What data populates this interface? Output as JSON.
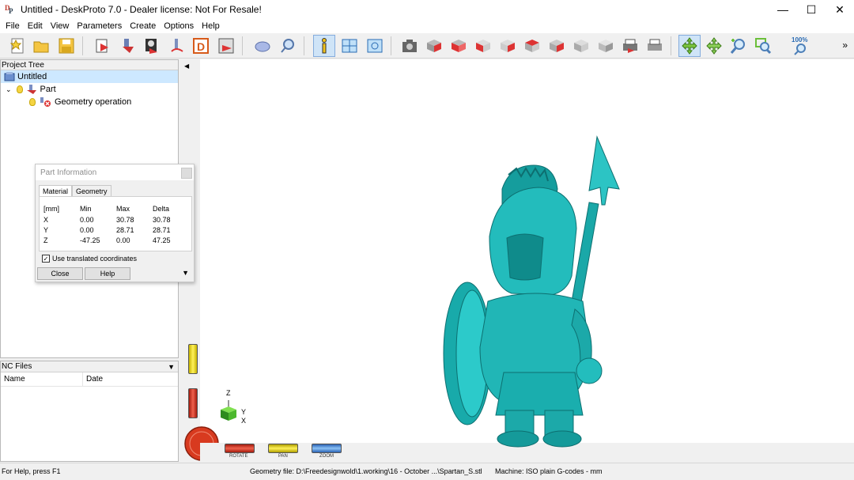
{
  "window": {
    "title": "Untitled - DeskProto 7.0 - Dealer license: Not For Resale!",
    "minimize": "—",
    "maximize": "☐",
    "close": "✕"
  },
  "menu": [
    "File",
    "Edit",
    "View",
    "Parameters",
    "Create",
    "Options",
    "Help"
  ],
  "toolbar": {
    "zoom_label": "100%",
    "more": "»",
    "icons": [
      "new-project-icon",
      "open-icon",
      "save-icon",
      "load-geometry-icon",
      "part-icon",
      "bitmap-icon",
      "toolpath-icon",
      "d-icon",
      "export-icon",
      "shapes-icon",
      "preview-icon",
      "info-icon",
      "layout-icon",
      "view-icon",
      "camera-icon",
      "view-front-icon",
      "view-back-icon",
      "view-left-icon",
      "view-right-icon",
      "view-top-icon",
      "view-bottom-icon",
      "view-iso-icon",
      "view-iso2-icon",
      "print-icon",
      "print-setup-icon",
      "rotate-icon",
      "pan-icon",
      "zoom-in-icon",
      "zoom-window-icon",
      "zoom-100-icon"
    ]
  },
  "project_tree": {
    "header": "Project Tree",
    "root": "Untitled",
    "part": "Part",
    "operation": "Geometry operation"
  },
  "nc_files": {
    "header": "NC Files",
    "col_name": "Name",
    "col_date": "Date"
  },
  "part_info": {
    "title": "Part Information",
    "tabs": [
      "Material",
      "Geometry"
    ],
    "header": [
      "[mm]",
      "Min",
      "Max",
      "Delta"
    ],
    "rows": [
      [
        "X",
        "0.00",
        "30.78",
        "30.78"
      ],
      [
        "Y",
        "0.00",
        "28.71",
        "28.71"
      ],
      [
        "Z",
        "-47.25",
        "0.00",
        "47.25"
      ]
    ],
    "checkbox_label": "Use translated coordinates",
    "checkbox_checked": true,
    "close_label": "Close",
    "help_label": "Help"
  },
  "viewport": {
    "axis_z": "Z",
    "axis_y": "Y",
    "axis_x": "X",
    "rotate_label": "ROTATE",
    "pan_label": "PAN",
    "zoom_label": "ZOOM",
    "model_color": "#1fb5b5"
  },
  "status": {
    "help": "For Help, press F1",
    "geometry_file": "Geometry file: D:\\Freedesignwold\\1.working\\16 - October ...\\Spartan_S.stl",
    "machine": "Machine: ISO plain G-codes - mm"
  }
}
